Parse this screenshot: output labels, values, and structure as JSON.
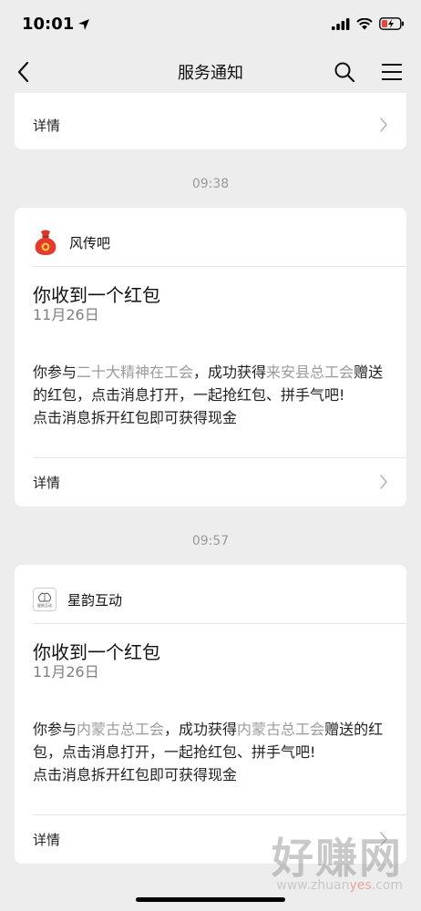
{
  "status_bar": {
    "time": "10:01"
  },
  "nav": {
    "title": "服务通知"
  },
  "top_card": {
    "detail_label": "详情"
  },
  "messages": [
    {
      "timestamp": "09:38",
      "sender": "风传吧",
      "logo_icon": "red-packet-bag-icon",
      "title": "你收到一个红包",
      "date": "11月26日",
      "body": {
        "p1": "你参与",
        "h1": "二十大精神在工会",
        "p2": "，成功获得",
        "h2": "来安县总工会",
        "p3": "赠送的红包，点击消息打开，一起抢红包、拼手气吧!",
        "line2": "点击消息拆开红包即可获得现金"
      },
      "detail_label": "详情"
    },
    {
      "timestamp": "09:57",
      "sender": "星韵互动",
      "logo_icon": "xingyun-logo-icon",
      "logo_text": "星韵互动",
      "title": "你收到一个红包",
      "date": "11月26日",
      "body": {
        "p1": "你参与",
        "h1": "内蒙古总工会",
        "p2": "，成功获得",
        "h2": "内蒙古总工会",
        "p3": "赠送的红包，点击消息打开，一起抢红包、拼手气吧!",
        "line2": "点击消息拆开红包即可获得现金"
      },
      "detail_label": "详情"
    }
  ],
  "watermark": {
    "big": "好赚网",
    "small_1": "www.zhuan",
    "small_2": "yes",
    "small_3": ".com"
  },
  "colors": {
    "background": "#ededed",
    "card": "#ffffff",
    "highlight_text": "#9b9b9b",
    "watermark_accent": "#e5533c"
  }
}
